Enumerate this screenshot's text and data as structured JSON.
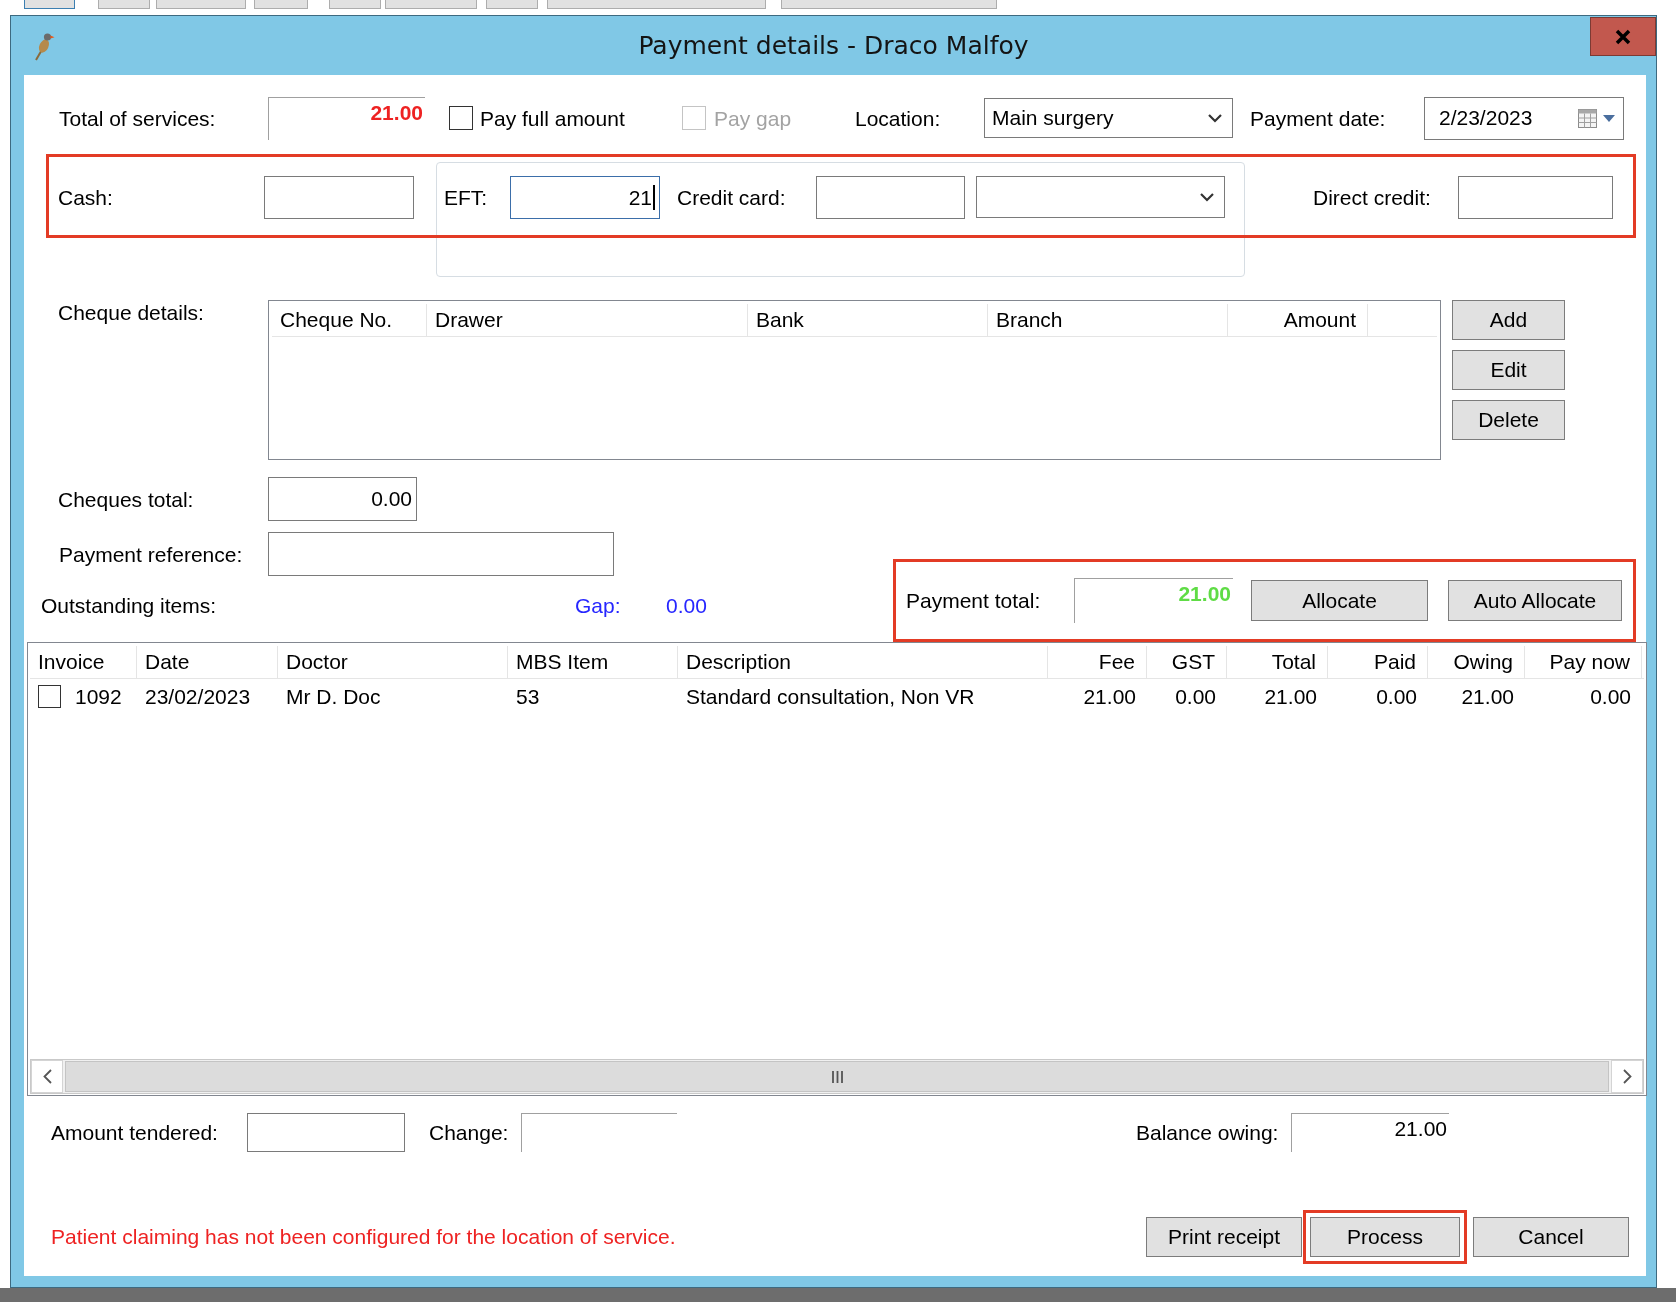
{
  "window": {
    "title": "Payment details - Draco Malfoy"
  },
  "summary": {
    "total_label": "Total of services:",
    "total_value": "21.00",
    "pay_full": {
      "label": "Pay full amount",
      "checked": false,
      "disabled": false
    },
    "pay_gap": {
      "label": "Pay gap",
      "checked": false,
      "disabled": true
    },
    "location": {
      "label": "Location:",
      "value": "Main surgery"
    },
    "payment_date": {
      "label": "Payment date:",
      "value": "2/23/2023"
    }
  },
  "payment_methods": {
    "highlighted": true,
    "cash": {
      "label": "Cash:",
      "focused": false
    },
    "eft": {
      "label": "EFT:",
      "value": "21",
      "focused": true
    },
    "credit_card": {
      "label": "Credit card:",
      "focused": false
    },
    "card_type": {
      "focused": false
    },
    "direct_credit": {
      "label": "Direct credit:",
      "focused": false
    }
  },
  "cheques": {
    "label": "Cheque details:",
    "columns": [
      "Cheque No.",
      "Drawer",
      "Bank",
      "Branch",
      "Amount"
    ],
    "buttons": [
      "Add",
      "Edit",
      "Delete"
    ]
  },
  "cheques_total": {
    "label": "Cheques total:",
    "value": "0.00"
  },
  "payment_reference": {
    "label": "Payment reference:"
  },
  "outstanding": {
    "label": "Outstanding items:",
    "gap_label": "Gap:",
    "gap_value": "0.00"
  },
  "payment_total": {
    "highlighted": true,
    "label": "Payment total:",
    "value": "21.00",
    "buttons": [
      "Allocate",
      "Auto Allocate"
    ]
  },
  "items_table": {
    "columns": [
      "Invoice",
      "Date",
      "Doctor",
      "MBS Item",
      "Description",
      "Fee",
      "GST",
      "Total",
      "Paid",
      "Owing",
      "Pay now"
    ],
    "rows": [
      {
        "checked": false,
        "cells": [
          "1092",
          "23/02/2023",
          "Mr D. Doc",
          "53",
          "Standard consultation, Non VR",
          "21.00",
          "0.00",
          "21.00",
          "0.00",
          "21.00",
          "0.00"
        ]
      }
    ]
  },
  "tender": {
    "amount_tendered": {
      "label": "Amount tendered:"
    },
    "change": {
      "label": "Change:"
    },
    "balance_owing": {
      "label": "Balance owing:",
      "value": "21.00"
    }
  },
  "message": "Patient claiming has not been configured for the location of service.",
  "buttons": [
    {
      "label": "Print receipt",
      "highlighted": false
    },
    {
      "label": "Process",
      "highlighted": true
    },
    {
      "label": "Cancel",
      "highlighted": false
    }
  ]
}
